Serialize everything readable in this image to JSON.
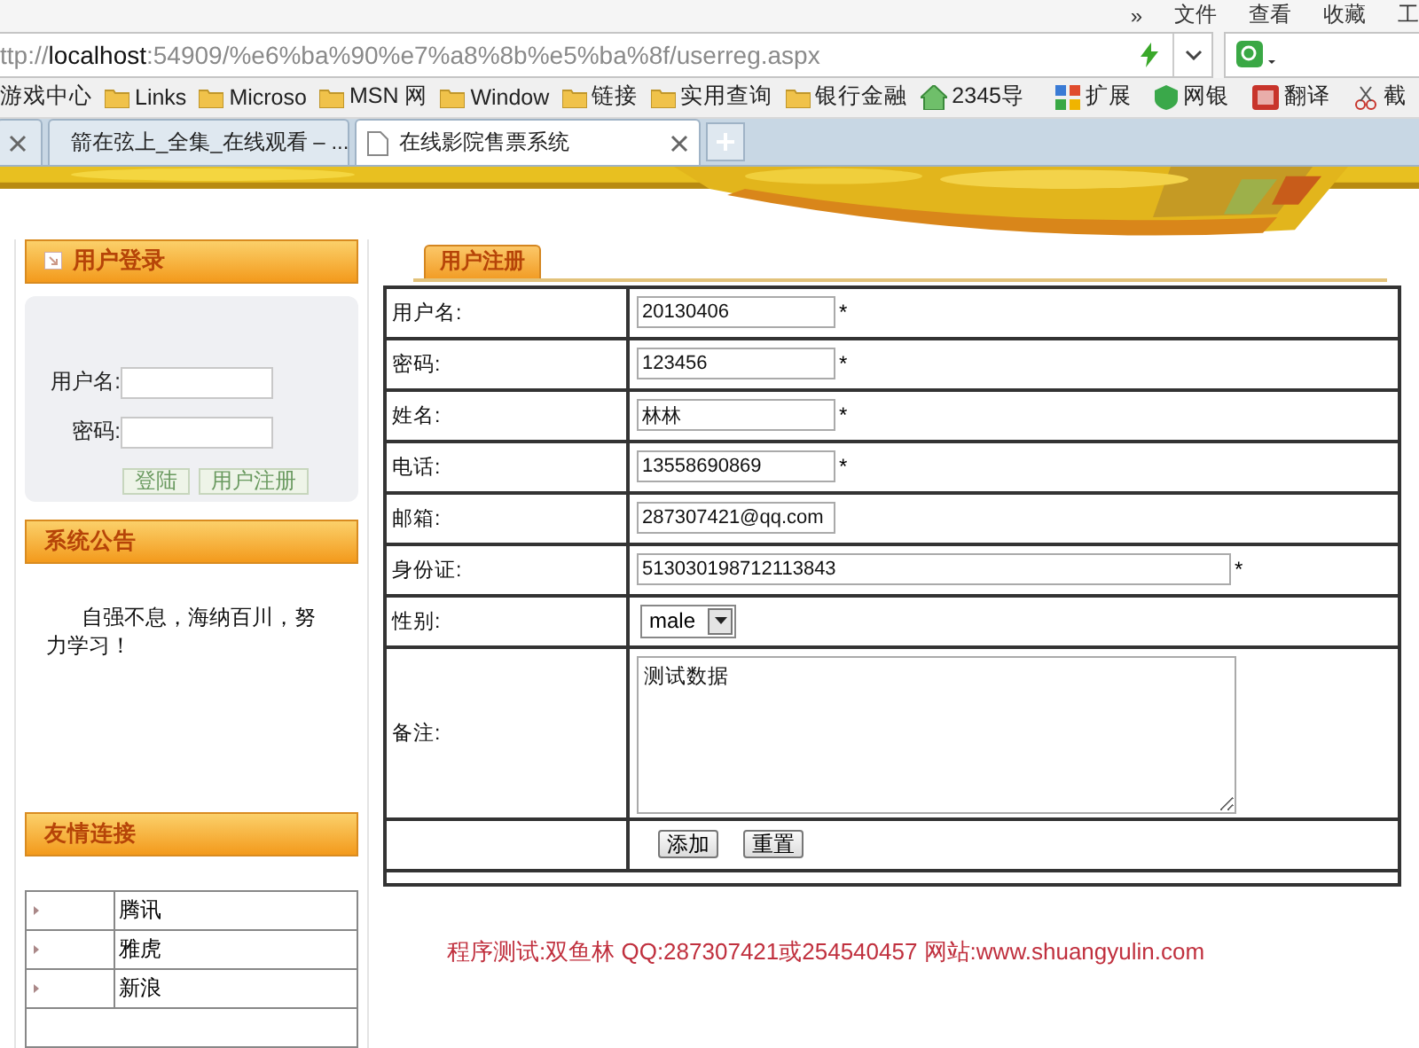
{
  "menu": [
    "»",
    "文件",
    "查看",
    "收藏",
    "工"
  ],
  "address": {
    "url": "ttp://**localhost**:54909/%e6%ba%90%e7%a8%8b%e5%ba%8f/userreg.aspx"
  },
  "bookmarks": [
    {
      "label": "游戏中心",
      "kind": "plain"
    },
    {
      "label": "Links",
      "kind": "folder"
    },
    {
      "label": "Microso",
      "kind": "folder"
    },
    {
      "label": "MSN 网",
      "kind": "folder"
    },
    {
      "label": "Window",
      "kind": "folder"
    },
    {
      "label": "链接",
      "kind": "folder"
    },
    {
      "label": "实用查询",
      "kind": "folder"
    },
    {
      "label": "银行金融",
      "kind": "folder"
    },
    {
      "label": "2345导",
      "kind": "site"
    }
  ],
  "tools": [
    {
      "label": "扩展",
      "kind": "grid"
    },
    {
      "label": "网银",
      "kind": "shield"
    },
    {
      "label": "翻译",
      "kind": "translate"
    },
    {
      "label": "截",
      "kind": "cut"
    }
  ],
  "tabs": [
    {
      "label": "箭在弦上_全集_在线观看 – ...",
      "selected": false,
      "kind": "site"
    },
    {
      "label": "在线影院售票系统",
      "selected": true,
      "kind": "page"
    }
  ],
  "sidebar": {
    "login": {
      "title": "用户登录",
      "fields": [
        {
          "label": "用户名:"
        },
        {
          "label": "密码:"
        }
      ],
      "buttons": [
        "登陆",
        "用户注册"
      ]
    },
    "notice": {
      "title": "系统公告",
      "text": "自强不息，海纳百川，努力学习！"
    },
    "links": {
      "title": "友情连接",
      "items": [
        "腾讯",
        "雅虎",
        "新浪"
      ]
    }
  },
  "form": {
    "tab": "用户注册",
    "rows": [
      {
        "label": "用户名:",
        "kind": "text",
        "value": "20130406",
        "note": "*"
      },
      {
        "label": "密码:",
        "kind": "text",
        "value": "123456",
        "note": "*"
      },
      {
        "label": "姓名:",
        "kind": "text",
        "value": "林林",
        "note": "*"
      },
      {
        "label": "电话:",
        "kind": "text",
        "value": "13558690869",
        "note": "*"
      },
      {
        "label": "邮箱:",
        "kind": "text",
        "value": "287307421@qq.com"
      },
      {
        "label": "身份证:",
        "kind": "wide",
        "value": "513030198712113843",
        "note": "*"
      },
      {
        "label": "性别:",
        "kind": "select",
        "value": "male"
      },
      {
        "label": "备注:",
        "kind": "textarea",
        "value": "测试数据"
      }
    ],
    "buttons": [
      "添加",
      "重置"
    ]
  },
  "footer": "程序测试:双鱼林 QQ:287307421或254540457 网站:www.shuangyulin.com"
}
